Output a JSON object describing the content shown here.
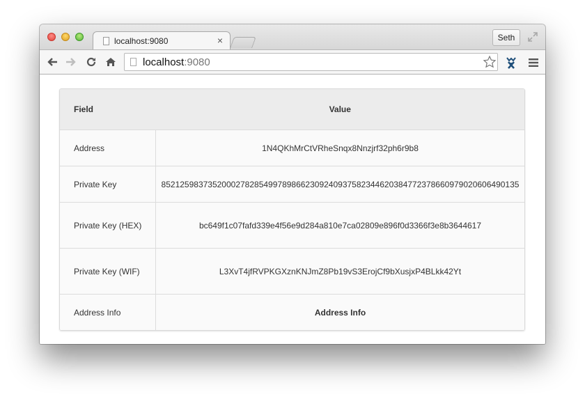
{
  "tab": {
    "title": "localhost:9080",
    "close": "×"
  },
  "user": {
    "name": "Seth"
  },
  "address_bar": {
    "host": "localhost",
    "port": ":9080"
  },
  "table": {
    "headers": {
      "field": "Field",
      "value": "Value"
    },
    "rows": [
      {
        "field": "Address",
        "value": "1N4QKhMrCtVRheSnqx8Nnzjrf32ph6r9b8"
      },
      {
        "field": "Private Key",
        "value": "85212598373520002782854997898662309240937582344620384772378660979020606490135"
      },
      {
        "field": "Private Key (HEX)",
        "value": "bc649f1c07fafd339e4f56e9d284a810e7ca02809e896f0d3366f3e8b3644617"
      },
      {
        "field": "Private Key (WIF)",
        "value": "L3XvT4jfRVPKGXznKNJmZ8Pb19vS3ErojCf9bXusjxP4BLkk42Yt"
      },
      {
        "field": "Address Info",
        "value": "Address Info"
      }
    ]
  },
  "icons": [
    "back-icon",
    "forward-icon",
    "reload-icon",
    "home-icon",
    "star-icon",
    "extension-icon",
    "menu-icon",
    "fullscreen-icon",
    "document-icon"
  ],
  "colors": {
    "close": "#e0443e",
    "minimize": "#dea123",
    "zoom": "#57b33a",
    "extension": "#1f4f7a"
  }
}
